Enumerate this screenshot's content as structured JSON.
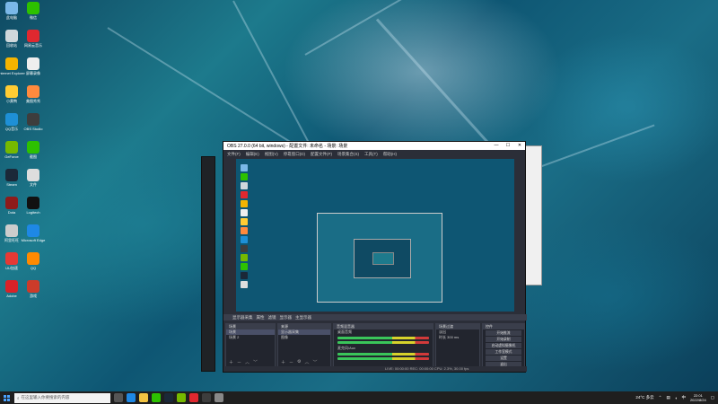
{
  "desktop": {
    "icons": [
      {
        "label": "此电脑",
        "color": "#7ab8e8"
      },
      {
        "label": "微信",
        "color": "#2dc100"
      },
      {
        "label": "回收站",
        "color": "#cfd8dc"
      },
      {
        "label": "网易云音乐",
        "color": "#e0282f"
      },
      {
        "label": "Internet Explorer",
        "color": "#f4b400"
      },
      {
        "label": "屏幕录像",
        "color": "#eeeeee"
      },
      {
        "label": "小黄鸭",
        "color": "#ffcc33"
      },
      {
        "label": "美图秀秀",
        "color": "#ff8a3d"
      },
      {
        "label": "QQ音乐",
        "color": "#1e90d6"
      },
      {
        "label": "OBS Studio",
        "color": "#3d3d3d"
      },
      {
        "label": "GeForce",
        "color": "#76b900"
      },
      {
        "label": "截图",
        "color": "#2dc100"
      },
      {
        "label": "Steam",
        "color": "#1b2838"
      },
      {
        "label": "文件",
        "color": "#dddddd"
      },
      {
        "label": "Dota",
        "color": "#8e1b1b"
      },
      {
        "label": "Logitech",
        "color": "#111111"
      },
      {
        "label": "阿里旺旺",
        "color": "#cccccc"
      },
      {
        "label": "Microsoft Edge",
        "color": "#1e88e5"
      },
      {
        "label": "UU加速",
        "color": "#e53935"
      },
      {
        "label": "QQ",
        "color": "#ff8a00"
      },
      {
        "label": "Adobe",
        "color": "#d92228"
      },
      {
        "label": "游戏",
        "color": "#cc3b2a"
      }
    ]
  },
  "obs": {
    "title": "OBS 27.0.0 (64 bit, windows) - 配置文件: 未命名 - 场景: 场景",
    "menu": [
      "文件(F)",
      "编辑(E)",
      "视图(V)",
      "停靠窗口(D)",
      "配置文件(P)",
      "场景集合(S)",
      "工具(T)",
      "帮助(H)"
    ],
    "dock_bar": [
      "显示器采集",
      "属性",
      "滤镜",
      "显示器",
      "主显示器"
    ],
    "scenes": {
      "header": "场景",
      "items": [
        "场景",
        "场景 2"
      ]
    },
    "sources": {
      "header": "来源",
      "items": [
        "显示器采集",
        "图像"
      ]
    },
    "mixer": {
      "header": "音频混音器",
      "channels": [
        {
          "label": "桌面音频",
          "db": "0.0 dB"
        },
        {
          "label": "麦克风/Aux",
          "db": "0.0 dB"
        }
      ]
    },
    "transitions": {
      "header": "场景过渡",
      "type": "淡出",
      "duration_label": "时长",
      "duration": "300 ms"
    },
    "controls": {
      "header": "控件",
      "buttons": [
        "开始推流",
        "开始录制",
        "启动虚拟摄像机",
        "工作室模式",
        "设置",
        "退出"
      ]
    },
    "status": "LIVE: 00:00:00   REC: 00:00:00   CPU: 2.3%, 30.00 fps"
  },
  "taskbar": {
    "search_placeholder": "在这里输入你要搜索的内容",
    "tray": {
      "temp": "24°C 多云",
      "lang": "中",
      "time": "22:01",
      "date": "2022/8/24"
    }
  }
}
